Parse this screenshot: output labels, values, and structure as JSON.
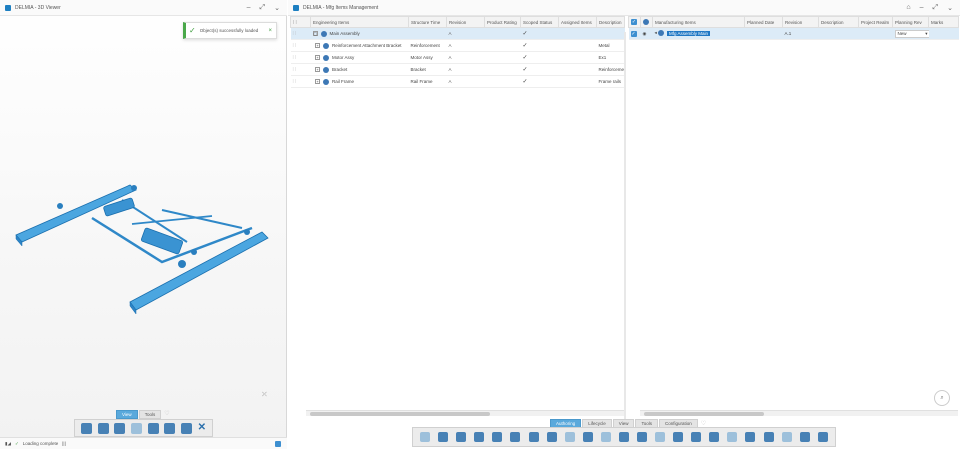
{
  "viewer": {
    "title": "DELMIA - 3D Viewer",
    "toast": "Object(s) successfully loaded",
    "tabs": [
      "View",
      "Tools"
    ],
    "status": "Loading complete"
  },
  "manager": {
    "title": "DELMIA - Mfg Items Management",
    "left_table": {
      "columns": [
        "Engineering Items",
        "Structure Time",
        "Revision",
        "Product Rating",
        "Scoped Status",
        "Assigned Items",
        "Description"
      ],
      "rows": [
        {
          "name": "Main Assembly",
          "structure": "",
          "revision": "A",
          "rating": "",
          "scoped": "✓",
          "assigned": "",
          "description": ""
        },
        {
          "name": "Reinforcement Attachment Bracket",
          "structure": "Reinforcement",
          "revision": "A",
          "rating": "",
          "scoped": "✓",
          "assigned": "",
          "description": "Metal"
        },
        {
          "name": "Motor Assy",
          "structure": "Motor Assy",
          "revision": "A",
          "rating": "",
          "scoped": "✓",
          "assigned": "",
          "description": "Ex1"
        },
        {
          "name": "Bracket",
          "structure": "Bracket",
          "revision": "A",
          "rating": "",
          "scoped": "✓",
          "assigned": "",
          "description": "Reinforcement"
        },
        {
          "name": "Rail Frame",
          "structure": "Rail Frame",
          "revision": "A",
          "rating": "",
          "scoped": "✓",
          "assigned": "",
          "description": "Frame rails"
        }
      ]
    },
    "right_table": {
      "columns": [
        "Manufacturing Items",
        "Planned Date",
        "Revision",
        "Description",
        "Project Realm",
        "Planning Rev",
        "Marks"
      ],
      "row": {
        "name": "Mfg Assembly Main",
        "planned": "",
        "revision": "A.1",
        "description": "",
        "realm": "",
        "planning": "New"
      }
    },
    "tabs": [
      "Authoring",
      "Lifecycle",
      "View",
      "Tools",
      "Configuration"
    ],
    "active_tab": "Authoring"
  }
}
